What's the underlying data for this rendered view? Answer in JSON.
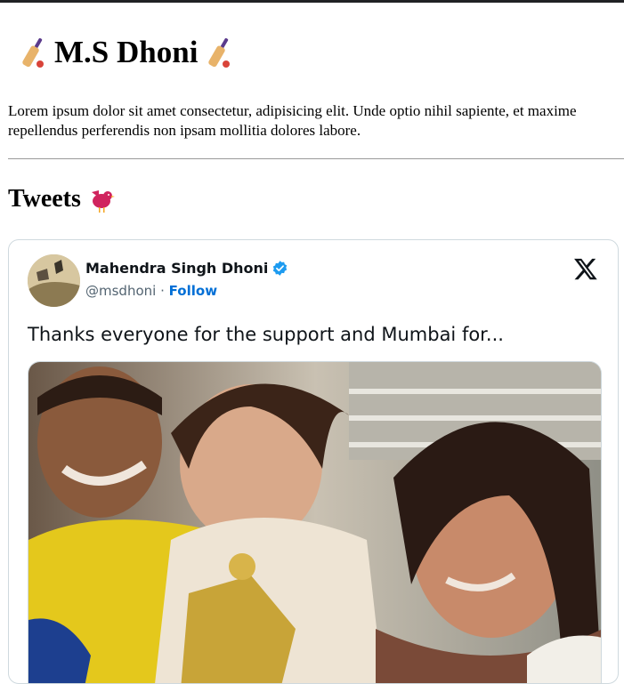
{
  "page": {
    "title": "M.S Dhoni",
    "intro": "Lorem ipsum dolor sit amet consectetur, adipisicing elit. Unde optio nihil sapiente, et maxime repellendus perferendis non ipsam mollitia dolores labore.",
    "tweets_heading": "Tweets",
    "icons": {
      "title_left": "cricket-bat-icon",
      "title_right": "cricket-bat-icon",
      "tweets": "bird-icon"
    }
  },
  "tweet": {
    "author_name": "Mahendra Singh Dhoni",
    "handle": "@msdhoni",
    "separator": "·",
    "follow_label": "Follow",
    "text": "Thanks everyone for the support and Mumbai for...",
    "verified": true,
    "colors": {
      "follow": "#006fd6",
      "verified": "#1d9bf0",
      "border": "#cfd9de"
    }
  }
}
